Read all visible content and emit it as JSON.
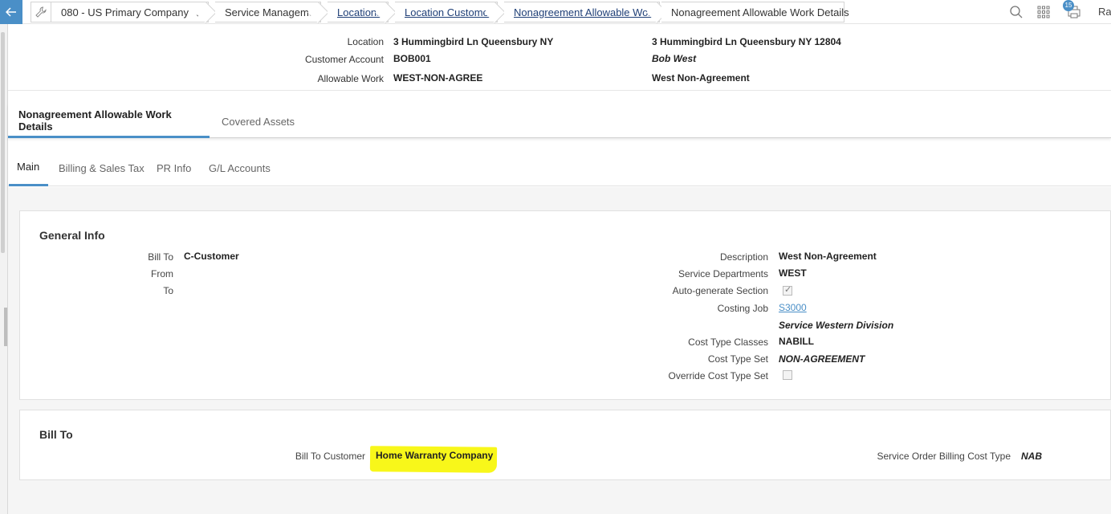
{
  "topbar": {
    "back_icon": "arrow-left-icon",
    "tool_icon": "wrench-icon",
    "company": "080 - US Primary Company",
    "breadcrumbs": [
      {
        "label": "Service Management",
        "link": false
      },
      {
        "label": "Locations",
        "link": true
      },
      {
        "label": "Location Customers",
        "link": true
      },
      {
        "label": "Nonagreement Allowable Work",
        "link": true
      },
      {
        "label": "Nonagreement Allowable Work Details",
        "link": false
      }
    ],
    "badge_count": "15",
    "user_fragment": "Ra"
  },
  "header": {
    "location_label": "Location",
    "location_value": "3 Hummingbird Ln Queensbury NY",
    "location_full": "3 Hummingbird Ln Queensbury NY 12804",
    "customer_label": "Customer Account",
    "customer_value": "BOB001",
    "customer_name": "Bob West",
    "work_label": "Allowable Work",
    "work_value": "WEST-NON-AGREE",
    "work_desc": "West Non-Agreement"
  },
  "tabs_top": [
    "Nonagreement Allowable Work Details",
    "Covered Assets"
  ],
  "tabs_sub": [
    "Main",
    "Billing & Sales Tax",
    "PR Info",
    "G/L Accounts"
  ],
  "general": {
    "title": "General Info",
    "bill_to_label": "Bill To",
    "bill_to_value": "C-Customer",
    "from_label": "From",
    "to_label": "To",
    "description_label": "Description",
    "description_value": "West Non-Agreement",
    "service_depts_label": "Service Departments",
    "service_depts_value": "WEST",
    "autogen_label": "Auto-generate Section",
    "autogen_checked": true,
    "costing_job_label": "Costing Job",
    "costing_job_value": "S3000",
    "costing_job_desc": "Service Western Division",
    "cost_type_classes_label": "Cost Type Classes",
    "cost_type_classes_value": "NABILL",
    "cost_type_set_label": "Cost Type Set",
    "cost_type_set_value": "NON-AGREEMENT",
    "override_label": "Override Cost Type Set",
    "override_checked": false
  },
  "billto": {
    "title": "Bill To",
    "customer_label": "Bill To Customer",
    "customer_value": "Home Warranty Company",
    "billing_cost_type_label": "Service Order Billing Cost Type",
    "billing_cost_type_value": "NAB"
  }
}
